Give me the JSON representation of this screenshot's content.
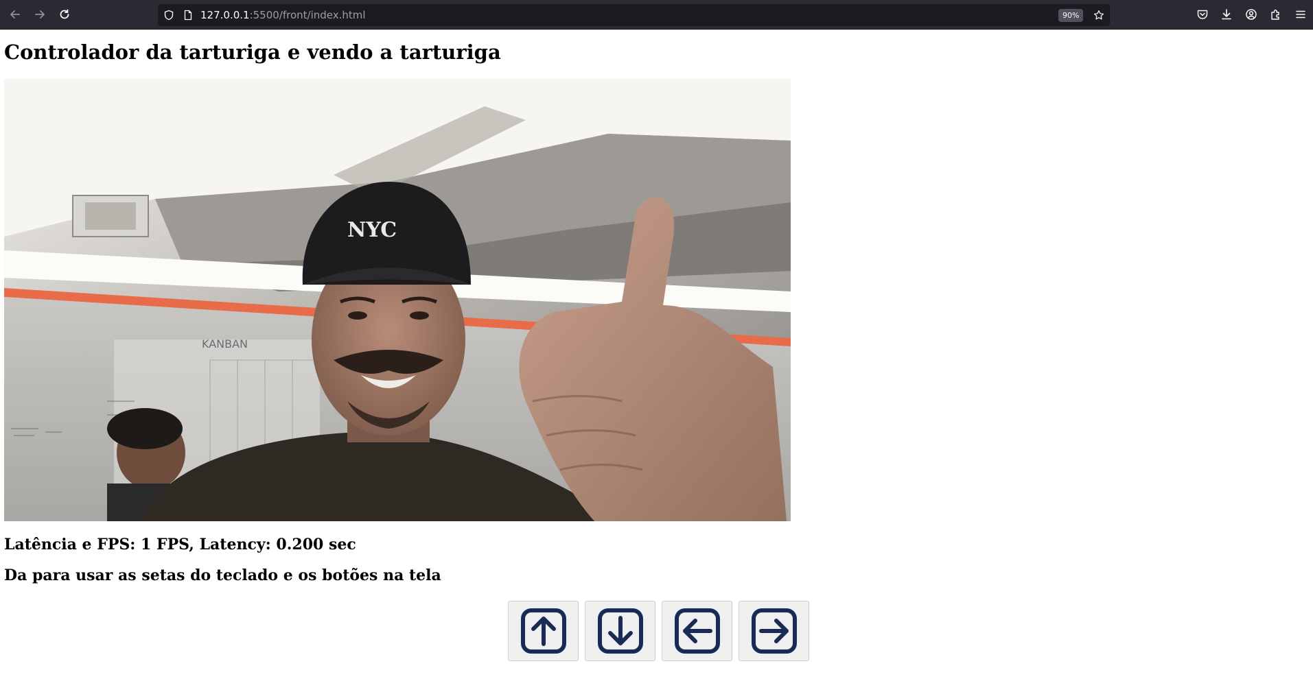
{
  "browser": {
    "url_host": "127.0.0.1",
    "url_path": ":5500/front/index.html",
    "zoom": "90%",
    "icons": [
      "back-icon",
      "forward-icon",
      "reload-icon",
      "shield-icon",
      "page-icon",
      "star-icon",
      "pocket-icon",
      "download-icon",
      "account-icon",
      "extensions-icon",
      "menu-icon"
    ]
  },
  "page": {
    "title": "Controlador da tarturiga e vendo a tarturiga",
    "stats": "Latência e FPS: 1 FPS, Latency: 0.200 sec",
    "hint": "Da para usar as setas do teclado e os botões na tela",
    "video_badge": "NYC",
    "whiteboard_text": "KANBAN"
  },
  "controls": [
    "arrow-up",
    "arrow-down",
    "arrow-left",
    "arrow-right"
  ],
  "colors": {
    "toolbar_bg": "#2b2a33",
    "urlbar_bg": "#1c1b22",
    "arrow_icon": "#1a2a57",
    "button_bg": "#efefef"
  }
}
